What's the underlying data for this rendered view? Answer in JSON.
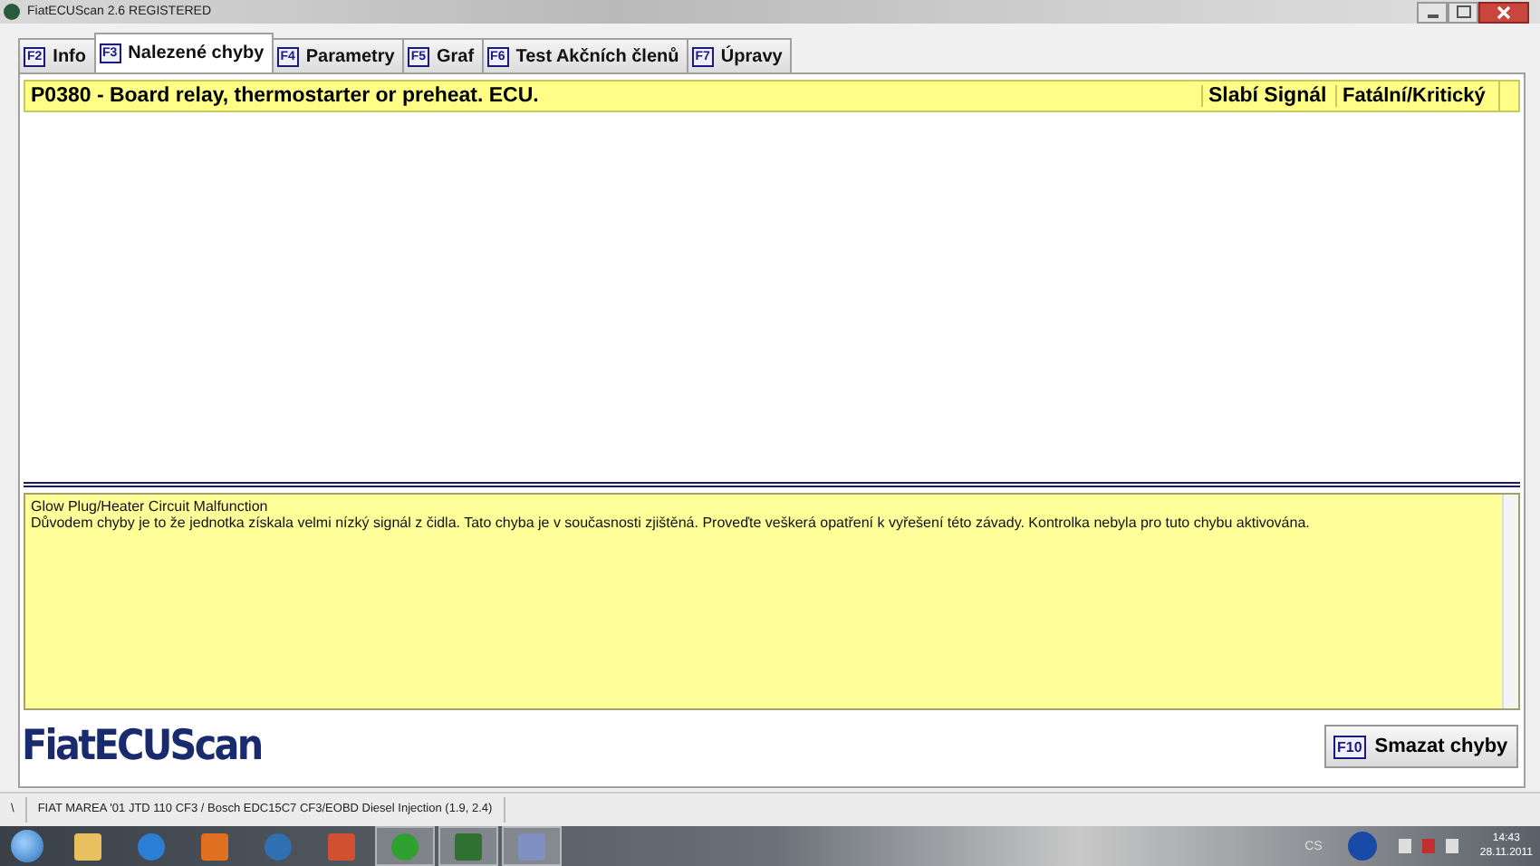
{
  "window": {
    "title": "FiatECUScan 2.6 REGISTERED"
  },
  "tabs": [
    {
      "key": "F2",
      "label": "Info",
      "selected": false
    },
    {
      "key": "F3",
      "label": "Nalezené chyby",
      "selected": true
    },
    {
      "key": "F4",
      "label": "Parametry",
      "selected": false
    },
    {
      "key": "F5",
      "label": "Graf",
      "selected": false
    },
    {
      "key": "F6",
      "label": "Test Akčních členů",
      "selected": false
    },
    {
      "key": "F7",
      "label": "Úpravy",
      "selected": false
    }
  ],
  "faults": [
    {
      "code": "P0380 - Board relay, thermostarter or preheat. ECU.",
      "signal": "Slabí Signál",
      "severity": "Fatální/Kritický",
      "selected": true
    }
  ],
  "description": {
    "title": "Glow Plug/Heater Circuit Malfunction",
    "text": "Důvodem chyby je to že jednotka získala velmi nízký signál z čidla. Tato chyba je v současnosti zjištěná. Proveďte veškerá opatření k vyřešení této závady. Kontrolka nebyla pro tuto chybu aktivována."
  },
  "logo": "FiatECUScan",
  "clear_button": {
    "key": "F10",
    "label": "Smazat chyby"
  },
  "status_bar": [
    "\\",
    "FIAT MAREA '01 JTD 110 CF3 / Bosch EDC15C7 CF3/EOBD Diesel Injection (1.9, 2.4)"
  ],
  "taskbar": {
    "apps": [
      {
        "kind": "folder",
        "open": false
      },
      {
        "kind": "browser",
        "open": false
      },
      {
        "kind": "media",
        "open": false
      },
      {
        "kind": "globe",
        "open": false
      },
      {
        "kind": "photos",
        "open": false
      },
      {
        "kind": "flower",
        "open": true
      },
      {
        "kind": "app",
        "open": true
      },
      {
        "kind": "paint",
        "open": true
      }
    ],
    "language": "CS",
    "time": "14:43",
    "date": "28.11.2011"
  }
}
